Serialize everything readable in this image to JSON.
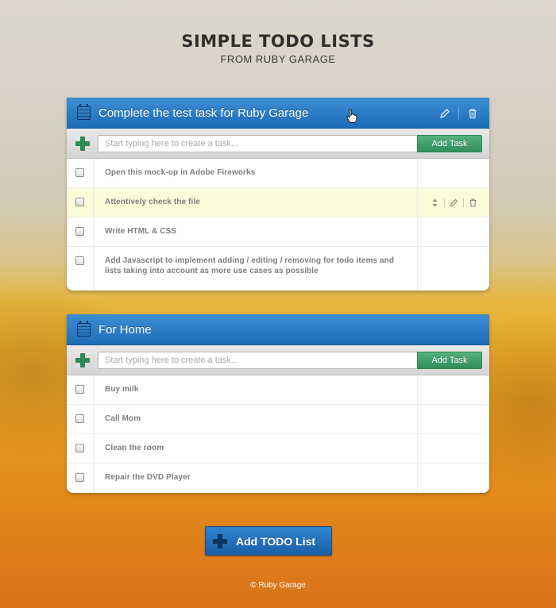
{
  "header": {
    "title": "SIMPLE TODO LISTS",
    "subtitle": "FROM RUBY GARAGE"
  },
  "add_task_placeholder": "Start typing here to create a task...",
  "add_task_label": "Add Task",
  "lists": [
    {
      "title": "Complete the test task for Ruby Garage",
      "tasks": [
        "Open this mock-up in Adobe Fireworks",
        "Attentively check the file",
        "Write HTML & CSS",
        "Add Javascript to implement adding / editing / removing for todo items and lists taking into account as more use cases as possible"
      ]
    },
    {
      "title": "For Home",
      "tasks": [
        "Buy milk",
        "Call Mom",
        "Clean the room",
        "Repair the DVD Player"
      ]
    }
  ],
  "add_list_label": "Add TODO List",
  "footer": "© Ruby Garage",
  "colors": {
    "header_blue": "#1d6cb8",
    "add_green": "#318d5a",
    "highlight_row": "#fbfcda"
  },
  "icons": [
    "calendar-icon",
    "pencil-icon",
    "trash-icon",
    "plus-icon",
    "sort-icon",
    "hand-cursor-icon"
  ]
}
